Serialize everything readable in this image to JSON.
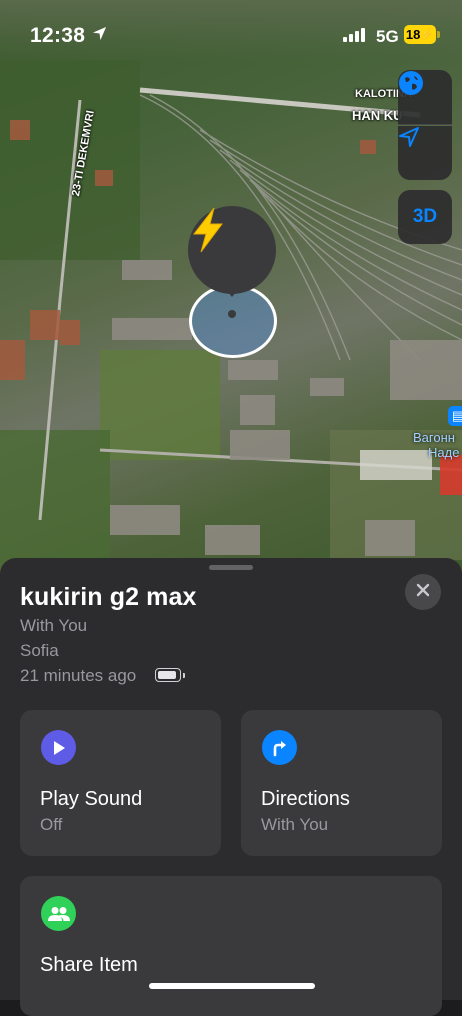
{
  "status_bar": {
    "time": "12:38",
    "network": "5G",
    "battery": "18"
  },
  "map": {
    "street_labels": [
      "KALOTINA",
      "HAN KU",
      "23-TI DEKEMVRI"
    ],
    "poi_label_line1": "Вагонн",
    "poi_label_line2": "Наде",
    "controls": {
      "globe_icon": "globe-icon",
      "tracking_icon": "location-arrow-icon",
      "three_d": "3D"
    },
    "pin_icon": "lightning-bolt-icon",
    "colors": {
      "accent": "#0a84ff",
      "pin": "#ffcc00"
    }
  },
  "item": {
    "name": "kukirin g2 max",
    "status": "With You",
    "city": "Sofia",
    "updated": "21 minutes ago",
    "battery_icon": "battery-full-icon"
  },
  "actions": {
    "play_sound": {
      "label": "Play Sound",
      "sub": "Off",
      "icon": "play-icon",
      "color": "#5e5ce6"
    },
    "directions": {
      "label": "Directions",
      "sub": "With You",
      "icon": "directions-arrow-icon",
      "color": "#0a84ff"
    },
    "share": {
      "label": "Share Item",
      "icon": "people-icon",
      "color": "#30d158"
    }
  }
}
